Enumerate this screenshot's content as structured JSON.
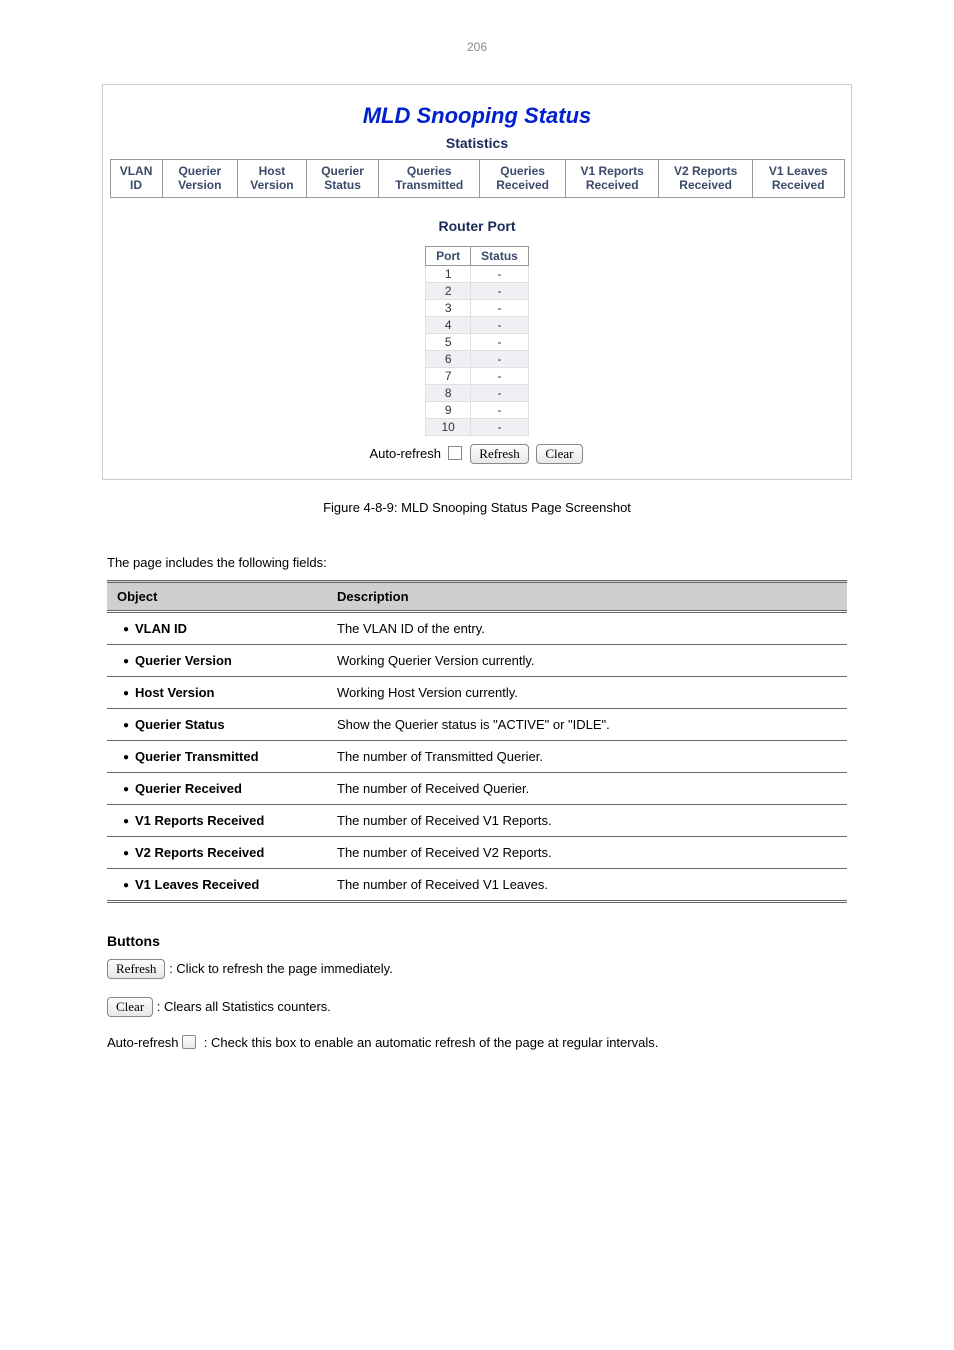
{
  "page_number": "206",
  "figure": {
    "title": "MLD Snooping Status",
    "subtitle": "Statistics",
    "stats_headers": [
      "VLAN ID",
      "Querier Version",
      "Host Version",
      "Querier Status",
      "Queries Transmitted",
      "Queries Received",
      "V1 Reports Received",
      "V2 Reports Received",
      "V1 Leaves Received"
    ],
    "router_title": "Router Port",
    "router_headers": [
      "Port",
      "Status"
    ],
    "router_rows": [
      {
        "port": "1",
        "status": "-"
      },
      {
        "port": "2",
        "status": "-"
      },
      {
        "port": "3",
        "status": "-"
      },
      {
        "port": "4",
        "status": "-"
      },
      {
        "port": "5",
        "status": "-"
      },
      {
        "port": "6",
        "status": "-"
      },
      {
        "port": "7",
        "status": "-"
      },
      {
        "port": "8",
        "status": "-"
      },
      {
        "port": "9",
        "status": "-"
      },
      {
        "port": "10",
        "status": "-"
      }
    ],
    "auto_refresh_label": "Auto-refresh",
    "refresh_btn": "Refresh",
    "clear_btn": "Clear"
  },
  "caption": "Figure 4-8-9: MLD Snooping Status Page Screenshot",
  "intro": "The page includes the following fields:",
  "desc": {
    "head_obj": "Object",
    "head_desc": "Description",
    "rows": [
      {
        "obj": "VLAN ID",
        "desc": "The VLAN ID of the entry."
      },
      {
        "obj": "Querier Version",
        "desc": "Working Querier Version currently."
      },
      {
        "obj": "Host Version",
        "desc": "Working Host Version currently."
      },
      {
        "obj": "Querier Status",
        "desc": "Show the Querier status is \"ACTIVE\" or \"IDLE\"."
      },
      {
        "obj": "Querier Transmitted",
        "desc": "The number of Transmitted Querier."
      },
      {
        "obj": "Querier Received",
        "desc": "The number of Received Querier."
      },
      {
        "obj": "V1 Reports Received",
        "desc": "The number of Received V1 Reports."
      },
      {
        "obj": "V2 Reports Received",
        "desc": "The number of Received V2 Reports."
      },
      {
        "obj": "V1 Leaves Received",
        "desc": "The number of Received V1 Leaves."
      }
    ]
  },
  "buttons_title": "Buttons",
  "btn_refresh_label": "Refresh",
  "btn_refresh_desc": ": Click to refresh the page immediately.",
  "btn_clear_label": "Clear",
  "btn_clear_desc": ": Clears all Statistics counters.",
  "auto_refresh_label": "Auto-refresh",
  "auto_refresh_desc": ": Check this box to enable an automatic refresh of the page at regular intervals."
}
